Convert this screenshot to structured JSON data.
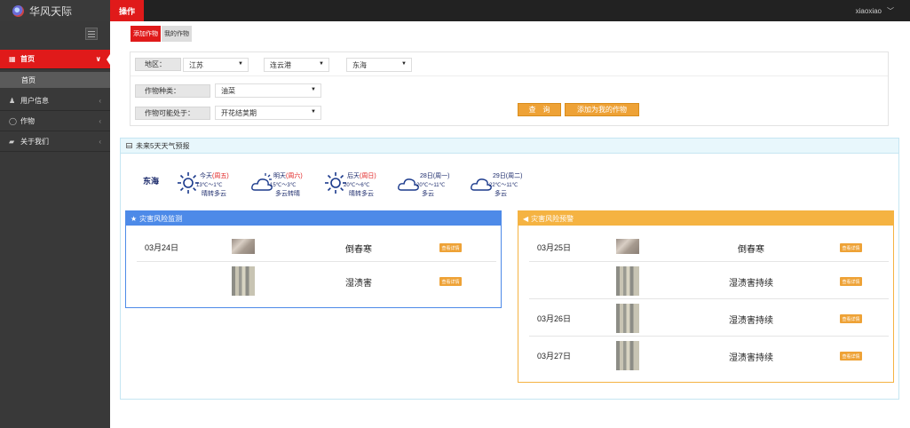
{
  "app": {
    "brand": "华风天际",
    "top_tab": "操作",
    "user": "xiaoxiao",
    "user_caret": "﹀"
  },
  "sidebar": {
    "items": [
      {
        "label": "首页",
        "icon": "grid-icon",
        "glyph": "▦",
        "arrow": "∨"
      },
      {
        "label": "首页",
        "sub": true
      },
      {
        "label": "用户信息",
        "icon": "user-icon",
        "glyph": "♟",
        "arrow": "‹"
      },
      {
        "label": "作物",
        "icon": "circle-icon",
        "glyph": "◯",
        "arrow": "‹"
      },
      {
        "label": "关于我们",
        "icon": "folder-icon",
        "glyph": "▰",
        "arrow": "‹"
      }
    ]
  },
  "tabs": {
    "add": "添加作物",
    "mine": "我的作物"
  },
  "search": {
    "region_label": "地区：",
    "province": "江苏",
    "city": "连云港",
    "county": "东海",
    "crop_label": "作物种类：",
    "crop": "油菜",
    "stage_label": "作物可能处于：",
    "stage": "开花结荚期",
    "query_btn": "查　询",
    "add_btn": "添加为我的作物"
  },
  "weather": {
    "title": "未来5天天气预报",
    "location": "东海",
    "days": [
      {
        "day": "今天",
        "week": "(周五)",
        "range": "13℃～1℃",
        "cond": "晴转多云",
        "icon": "sun-icon"
      },
      {
        "day": "明天",
        "week": "(周六)",
        "range": "15℃～3℃",
        "cond": "多云转晴",
        "icon": "cloud-sun-icon"
      },
      {
        "day": "后天",
        "week": "(周日)",
        "range": "20℃～6℃",
        "cond": "晴转多云",
        "icon": "sun-icon"
      },
      {
        "day": "28日",
        "week": "(周一)",
        "range": "20℃～11℃",
        "cond": "多云",
        "icon": "cloud-icon"
      },
      {
        "day": "29日",
        "week": "(周二)",
        "range": "22℃～11℃",
        "cond": "多云",
        "icon": "cloud-icon"
      }
    ]
  },
  "monitor": {
    "title": "灾害风险监测",
    "rows": [
      {
        "date": "03月24日",
        "name": "倒春寒",
        "badge": "查看详情"
      },
      {
        "date": "",
        "name": "湿渍害",
        "badge": "查看详情"
      }
    ]
  },
  "warning": {
    "title": "灾害风险预警",
    "rows": [
      {
        "date": "03月25日",
        "name": "倒春寒",
        "badge": "查看详情"
      },
      {
        "date": "",
        "name": "湿渍害持续",
        "badge": "查看详情"
      },
      {
        "date": "03月26日",
        "name": "湿渍害持续",
        "badge": "查看详情"
      },
      {
        "date": "03月27日",
        "name": "湿渍害持续",
        "badge": "查看详情"
      }
    ]
  },
  "colors": {
    "accent": "#e01a1a",
    "monitor_head": "#4d8ae8",
    "warning_head": "#f5b342",
    "button": "#eea236"
  }
}
